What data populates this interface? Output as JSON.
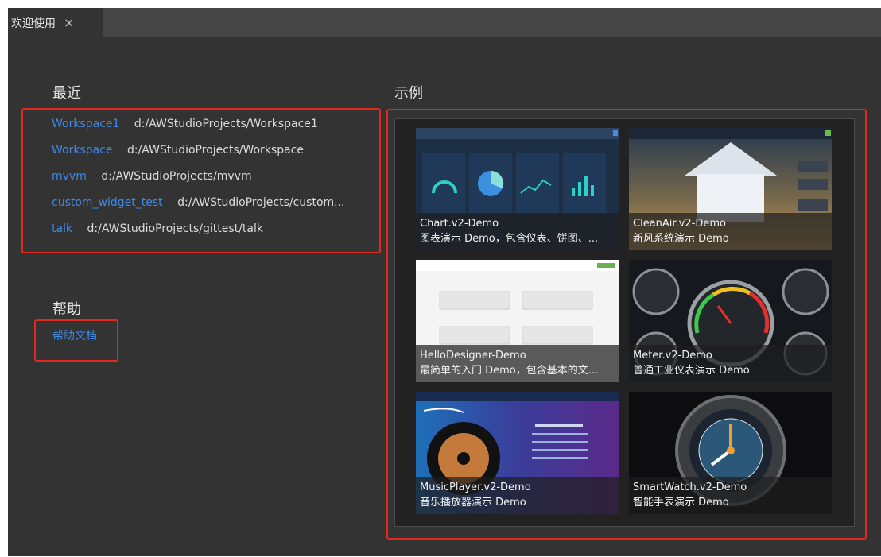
{
  "tab": {
    "label": "欢迎使用",
    "close_icon": "×"
  },
  "recent": {
    "title": "最近",
    "items": [
      {
        "name": "Workspace1",
        "path": "d:/AWStudioProjects/Workspace1"
      },
      {
        "name": "Workspace",
        "path": "d:/AWStudioProjects/Workspace"
      },
      {
        "name": "mvvm",
        "path": "d:/AWStudioProjects/mvvm"
      },
      {
        "name": "custom_widget_test",
        "path": "d:/AWStudioProjects/custom..."
      },
      {
        "name": "talk",
        "path": "d:/AWStudioProjects/gittest/talk"
      }
    ]
  },
  "help": {
    "title": "帮助",
    "link": "帮助文档"
  },
  "examples": {
    "title": "示例",
    "items": [
      {
        "title": "Chart.v2-Demo",
        "desc": "图表演示 Demo，包含仪表、饼图、..."
      },
      {
        "title": "CleanAir.v2-Demo",
        "desc": "新风系统演示 Demo"
      },
      {
        "title": "HelloDesigner-Demo",
        "desc": "最简单的入门 Demo，包含基本的文..."
      },
      {
        "title": "Meter.v2-Demo",
        "desc": "普通工业仪表演示 Demo"
      },
      {
        "title": "MusicPlayer.v2-Demo",
        "desc": "音乐播放器演示 Demo"
      },
      {
        "title": "SmartWatch.v2-Demo",
        "desc": "智能手表演示 Demo"
      }
    ]
  },
  "colors": {
    "accent_link": "#3e8ae4",
    "highlight_border": "#e0281e",
    "background": "#333333"
  }
}
